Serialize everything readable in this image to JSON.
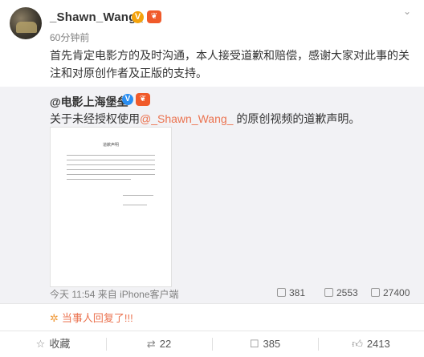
{
  "post": {
    "username": "_Shawn_Wang_",
    "time": "60分钟前",
    "text": "首先肯定电影方的及时沟通，本人接受道歉和赔偿，感谢大家对此事的关注和对原创作者及正版的支持。",
    "v_badge": "V",
    "vip_badge": "❦"
  },
  "repost": {
    "author": "@电影上海堡垒",
    "author_v": "V",
    "author_vip": "❦",
    "text_before": "关于未经授权使用",
    "mention": "@_Shawn_Wang_",
    "text_after": " 的原创视频的道歉声明。",
    "doc_title": "道歉声明",
    "meta": "今天 11:54 来自 iPhone客户端",
    "stats": {
      "reposts": "381",
      "comments": "2553",
      "likes": "27400"
    }
  },
  "comment_preview": {
    "icon": "✲",
    "text": "当事人回复了!!!"
  },
  "actions": {
    "favorite": "收藏",
    "repost": "22",
    "comment": "385",
    "like": "2413"
  }
}
